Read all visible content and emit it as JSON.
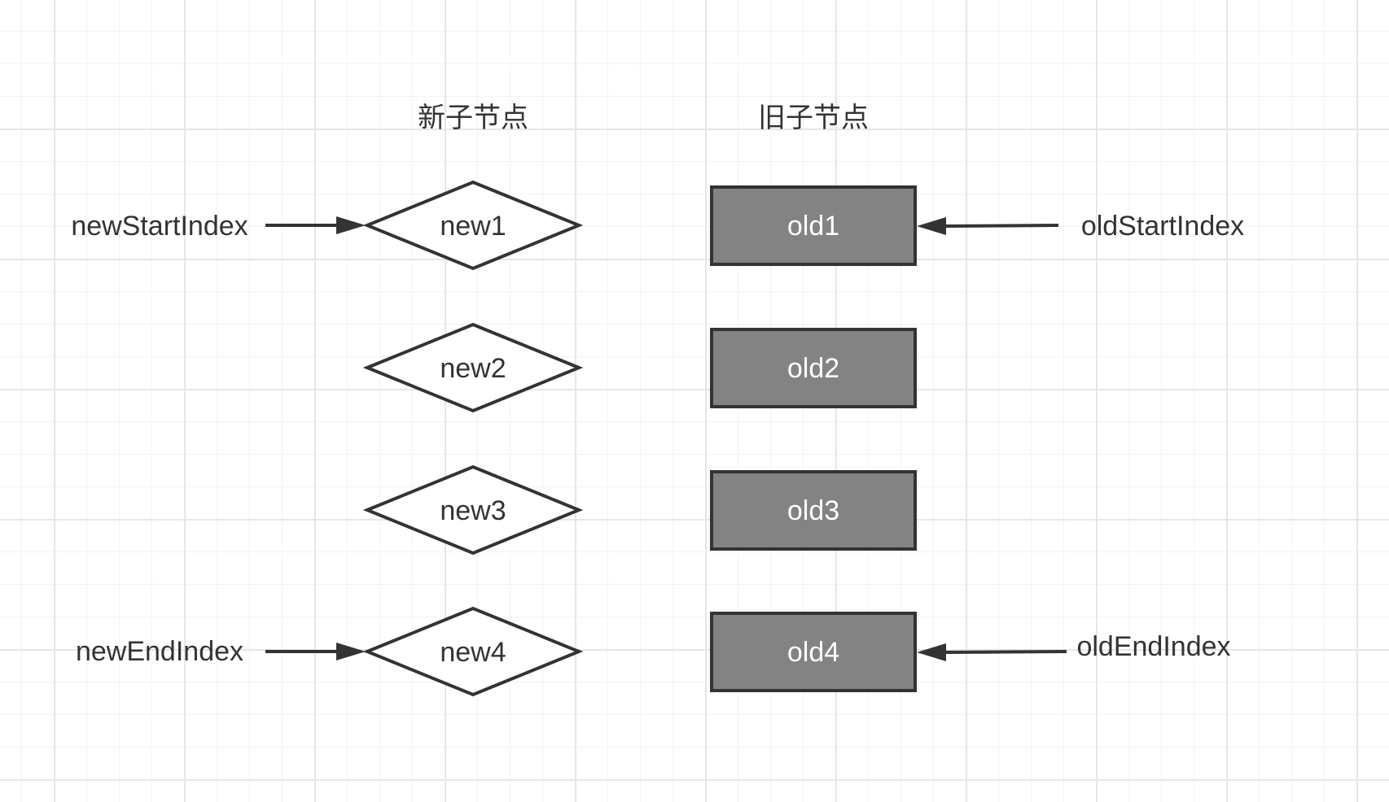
{
  "headings": {
    "new_children": "新子节点",
    "old_children": "旧子节点"
  },
  "new_nodes": [
    "new1",
    "new2",
    "new3",
    "new4"
  ],
  "old_nodes": [
    "old1",
    "old2",
    "old3",
    "old4"
  ],
  "pointers": {
    "new_start": "newStartIndex",
    "new_end": "newEndIndex",
    "old_start": "oldStartIndex",
    "old_end": "oldEndIndex"
  },
  "colors": {
    "old_node_fill": "#838383",
    "stroke": "#333333",
    "new_node_fill": "#ffffff"
  }
}
